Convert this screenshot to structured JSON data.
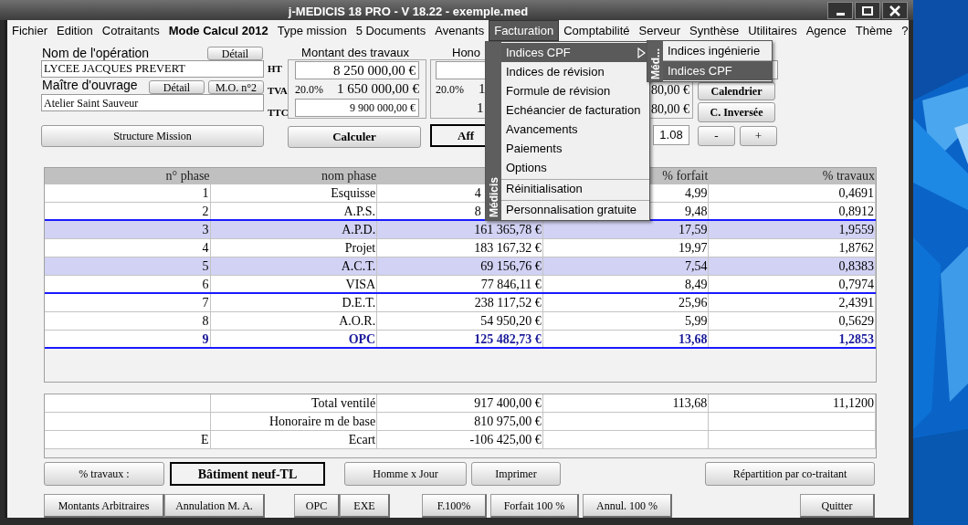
{
  "window": {
    "title": "j-MEDICIS 18 PRO - V 18.22 - exemple.med"
  },
  "menu_bar": [
    {
      "label": "Fichier",
      "selected": false
    },
    {
      "label": "Edition",
      "selected": false
    },
    {
      "label": "Cotraitants",
      "selected": false
    },
    {
      "label": "Mode Calcul 2012",
      "selected": false
    },
    {
      "label": "Type mission",
      "selected": false
    },
    {
      "label": "5 Documents",
      "selected": false
    },
    {
      "label": "Avenants",
      "selected": false
    },
    {
      "label": "Facturation",
      "selected": true
    },
    {
      "label": "Comptabilité",
      "selected": false
    },
    {
      "label": "Serveur",
      "selected": false
    },
    {
      "label": "Synthèse",
      "selected": false
    },
    {
      "label": "Utilitaires",
      "selected": false
    },
    {
      "label": "Agence",
      "selected": false
    },
    {
      "label": "Thème",
      "selected": false
    },
    {
      "label": "?",
      "selected": false
    }
  ],
  "menu": {
    "side_label": "Médicis",
    "items": [
      {
        "label": "Indices CPF",
        "kind": "submenu",
        "selected": true,
        "separator_before": false
      },
      {
        "label": "Indices de révision",
        "kind": "item",
        "selected": false,
        "separator_before": false
      },
      {
        "label": "Formule de révision",
        "kind": "item",
        "selected": false,
        "separator_before": false
      },
      {
        "label": "Echéancier de facturation",
        "kind": "item",
        "selected": false,
        "separator_before": false
      },
      {
        "label": "Avancements",
        "kind": "item",
        "selected": false,
        "separator_before": false
      },
      {
        "label": "Paiements",
        "kind": "item",
        "selected": false,
        "separator_before": false
      },
      {
        "label": "Options",
        "kind": "item",
        "selected": false,
        "separator_before": false
      },
      {
        "label": "Réinitialisation",
        "kind": "item",
        "selected": false,
        "separator_before": true
      },
      {
        "label": "Personnalisation gratuite",
        "kind": "item",
        "selected": false,
        "separator_before": true
      }
    ]
  },
  "submenu": {
    "side_label": "Méd...",
    "items": [
      {
        "label": "Indices ingénierie",
        "selected": false
      },
      {
        "label": "Indices CPF",
        "selected": true
      }
    ]
  },
  "operation": {
    "label": "Nom de l'opération",
    "button": "Détail",
    "value": "LYCEE JACQUES PREVERT"
  },
  "owner": {
    "label": "Maître d'ouvrage",
    "buttons": [
      "Détail",
      "M.O. n°2"
    ],
    "value": "Atelier Saint Sauveur"
  },
  "structure_button": "Structure Mission",
  "amount_labels": [
    "HT",
    "TVA",
    "TTC"
  ],
  "travaux": {
    "title": "Montant des travaux",
    "ht": "8 250 000,00 €",
    "tva_rate": "20.0%",
    "tva": "1 650 000,00 €",
    "ttc": "9 900 000,00 €"
  },
  "calculer_button": "Calculer",
  "honoraires": {
    "title": "Hono",
    "tva_rate": "20.0%",
    "tva": "1",
    "ttc": "1"
  },
  "affaire_button": "Aff",
  "honoraires_ttc": {
    "tva": "80,00 €",
    "ttc": "80,00 €"
  },
  "coefficient": "1.08",
  "side_buttons": [
    "Calendrier",
    "C. Inversée"
  ],
  "step_buttons": [
    "-",
    "+"
  ],
  "table": {
    "columns": [
      {
        "label": "n° phase"
      },
      {
        "label": "nom phase"
      },
      {},
      {
        "label": "% forfait"
      },
      {
        "label": "% travaux"
      }
    ],
    "rows": [
      {
        "cells": [
          "1",
          "Esquisse",
          "4",
          "4,99",
          "0,4691"
        ],
        "selected": false,
        "emphasis": false,
        "group_end": false
      },
      {
        "cells": [
          "2",
          "A.P.S.",
          "8",
          "9,48",
          "0,8912"
        ],
        "selected": false,
        "emphasis": false,
        "group_end": true
      },
      {
        "cells": [
          "3",
          "A.P.D.",
          "161 365,78 €",
          "17,59",
          "1,9559"
        ],
        "selected": true,
        "emphasis": false,
        "group_end": false
      },
      {
        "cells": [
          "4",
          "Projet",
          "183 167,32 €",
          "19,97",
          "1,8762"
        ],
        "selected": false,
        "emphasis": false,
        "group_end": false
      },
      {
        "cells": [
          "5",
          "A.C.T.",
          "69 156,76 €",
          "7,54",
          "0,8383"
        ],
        "selected": true,
        "emphasis": false,
        "group_end": false
      },
      {
        "cells": [
          "6",
          "VISA",
          "77 846,11 €",
          "8,49",
          "0,7974"
        ],
        "selected": false,
        "emphasis": false,
        "group_end": true
      },
      {
        "cells": [
          "7",
          "D.E.T.",
          "238 117,52 €",
          "25,96",
          "2,4391"
        ],
        "selected": false,
        "emphasis": false,
        "group_end": false
      },
      {
        "cells": [
          "8",
          "A.O.R.",
          "54 950,20 €",
          "5,99",
          "0,5629"
        ],
        "selected": false,
        "emphasis": false,
        "group_end": false
      },
      {
        "cells": [
          "9",
          "OPC",
          "125 482,73 €",
          "13,68",
          "1,2853"
        ],
        "selected": false,
        "emphasis": true,
        "group_end": true
      }
    ]
  },
  "totals": [
    {
      "label": "Total ventilé",
      "amount": "917 400,00 €",
      "forfait": "113,68",
      "travaux": "11,1200"
    },
    {
      "label": "Honoraire m de base",
      "amount": "810 975,00 €"
    },
    {
      "code": "E",
      "label": "Ecart",
      "amount": "-106 425,00 €"
    }
  ],
  "footer": [
    [
      {
        "label": "% travaux :",
        "kind": "button"
      },
      {
        "label": "Bâtiment neuf-TL",
        "kind": "label"
      },
      {
        "label": "Homme x Jour",
        "kind": "button"
      },
      {
        "label": "Imprimer",
        "kind": "button"
      },
      {
        "label": "Répartition par co-traitant",
        "kind": "button"
      }
    ],
    [
      {
        "label": "Montants Arbitraires",
        "kind": "button"
      },
      {
        "label": "Annulation M. A.",
        "kind": "button"
      },
      {
        "label": "OPC",
        "kind": "button"
      },
      {
        "label": "EXE",
        "kind": "button"
      },
      {
        "label": "F.100%",
        "kind": "button"
      },
      {
        "label": "Forfait 100 %",
        "kind": "button"
      },
      {
        "label": "Annul. 100 %",
        "kind": "button"
      },
      {
        "label": "Quitter",
        "kind": "button"
      }
    ]
  ]
}
